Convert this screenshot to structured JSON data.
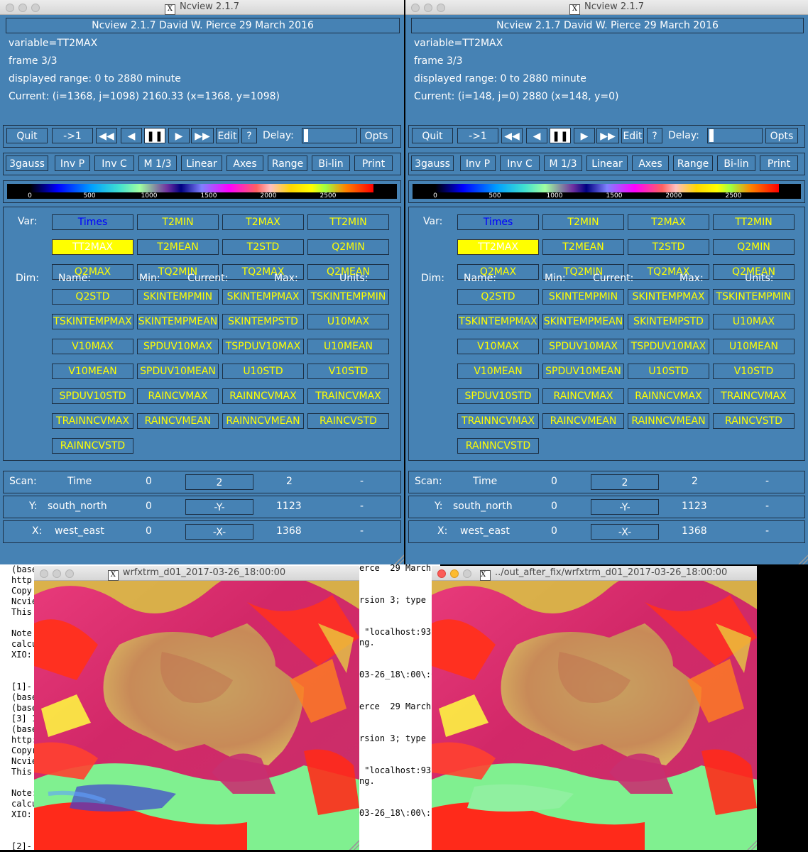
{
  "left_panel": {
    "window_title": "Ncview 2.1.7",
    "header": "Ncview 2.1.7 David W. Pierce  29 March 2016",
    "variable": "variable=TT2MAX",
    "frame": "frame 3/3",
    "range": "displayed range: 0 to 2880 minute",
    "current": "Current: (i=1368, j=1098) 2160.33 (x=1368, y=1098)"
  },
  "right_panel": {
    "window_title": "Ncview 2.1.7",
    "header": "Ncview 2.1.7 David W. Pierce  29 March 2016",
    "variable": "variable=TT2MAX",
    "frame": "frame 3/3",
    "range": "displayed range: 0 to 2880 minute",
    "current": "Current: (i=148, j=0) 2880 (x=148, y=0)"
  },
  "controls": {
    "quit": "Quit",
    "rewind": "->1",
    "fast_back": "◀◀",
    "back": "◀",
    "pause": "❚❚",
    "forward": "▶",
    "fast_forward": "▶▶",
    "edit": "Edit",
    "help": "?",
    "delay": "Delay:",
    "opts": "Opts"
  },
  "options": [
    "3gauss",
    "Inv P",
    "Inv C",
    "M 1/3",
    "Linear",
    "Axes",
    "Range",
    "Bi-lin",
    "Print"
  ],
  "colorbar_ticks": [
    "0",
    "500",
    "1000",
    "1500",
    "2000",
    "2500"
  ],
  "var_label": "Var:",
  "variables": [
    "Times",
    "T2MIN",
    "T2MAX",
    "TT2MIN",
    "TT2MAX",
    "T2MEAN",
    "T2STD",
    "Q2MIN",
    "Q2MAX",
    "TQ2MIN",
    "TQ2MAX",
    "Q2MEAN",
    "Q2STD",
    "SKINTEMPMIN",
    "SKINTEMPMAX",
    "TSKINTEMPMIN",
    "TSKINTEMPMAX",
    "SKINTEMPMEAN",
    "SKINTEMPSTD",
    "U10MAX",
    "V10MAX",
    "SPDUV10MAX",
    "TSPDUV10MAX",
    "U10MEAN",
    "V10MEAN",
    "SPDUV10MEAN",
    "U10STD",
    "V10STD",
    "SPDUV10STD",
    "RAINCVMAX",
    "RAINNCVMAX",
    "TRAINCVMAX",
    "TRAINNCVMAX",
    "RAINCVMEAN",
    "RAINNCVMEAN",
    "RAINCVSTD",
    "RAINNCVSTD"
  ],
  "dim_headers": {
    "dim": "Dim:",
    "name": "Name:",
    "min": "Min:",
    "current": "Current:",
    "max": "Max:",
    "units": "Units:"
  },
  "dims": [
    {
      "dim": "Scan:",
      "name": "Time",
      "min": "0",
      "current": "2",
      "max": "2",
      "units": "-"
    },
    {
      "dim": "Y:",
      "name": "south_north",
      "min": "0",
      "current": "-Y-",
      "max": "1123",
      "units": "-"
    },
    {
      "dim": "X:",
      "name": "west_east",
      "min": "0",
      "current": "-X-",
      "max": "1368",
      "units": "-"
    }
  ],
  "image_left": {
    "title": "wrfxtrm_d01_2017-03-26_18:00:00"
  },
  "image_right": {
    "title": "../out_after_fix/wrfxtrm_d01_2017-03-26_18:00:00"
  },
  "terminal": {
    "left_col": "(base\nhttp\nCopy\nNcvie\nThis\n\nNote\ncalcu\nXIO:\n\n\n[1]-\n(base\n(base\n[3] 1\n(base\nhttp:\nCopyr\nNcvie\nThis\n\nNote:\ncalcu\nXIO:\n\n\n[2]-",
    "mid_col": "erce  29 March\n\n\nrsion 3; type\n\n\n \"localhost:93\nng.\n\n\n03-26_18\\:00\\:0\n\n\nerce  29 March\n\n\nrsion 3; type\n\n\n \"localhost:93\nng.\n\n\n03-26_18\\:00\\:"
  }
}
